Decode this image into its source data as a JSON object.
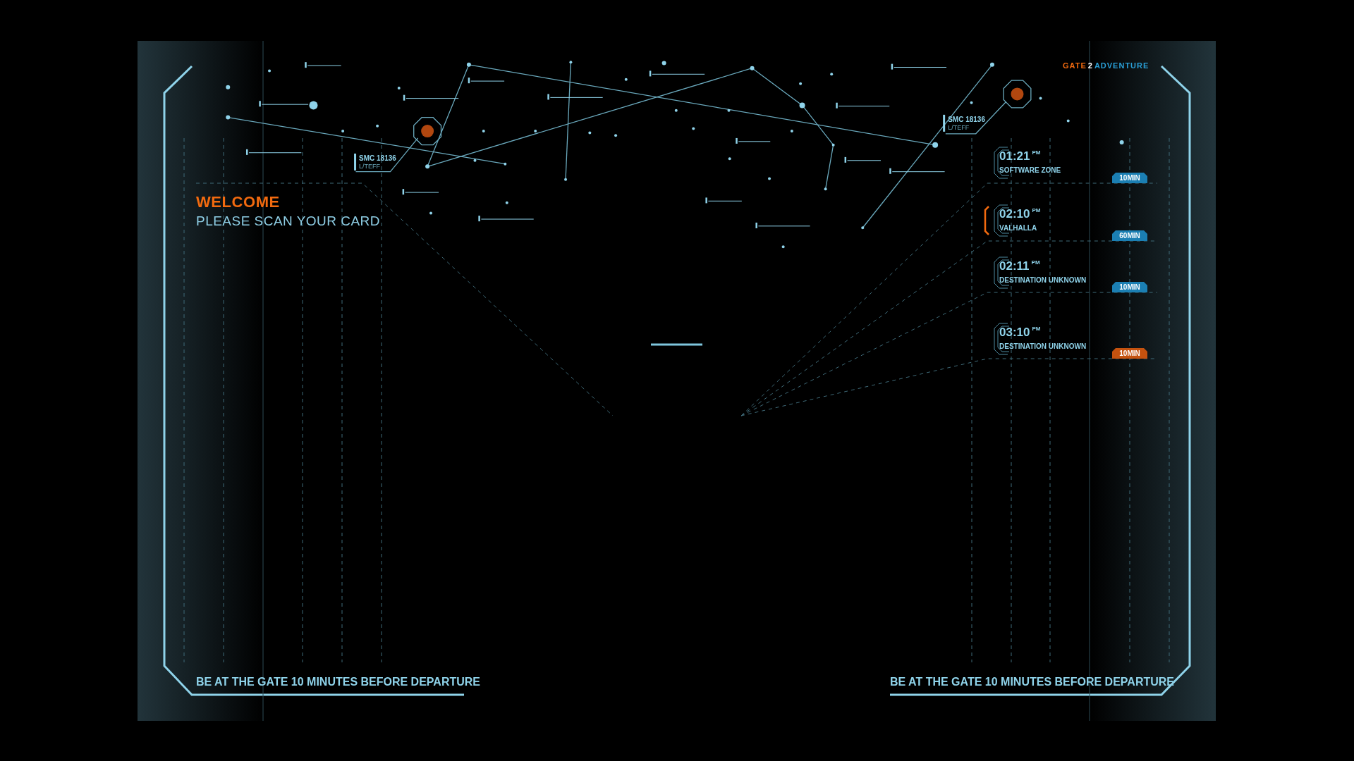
{
  "brand": {
    "first": "GATE",
    "middle": "2",
    "last": "ADVENTURE"
  },
  "welcome": {
    "title": "WELCOME",
    "prompt": "PLEASE SCAN YOUR CARD"
  },
  "star_labels": [
    {
      "code": "SMC 18136",
      "sub": "L/TEFF"
    },
    {
      "code": "SMC 18136",
      "sub": "L/TEFF"
    }
  ],
  "departures": [
    {
      "time": "01:21",
      "meridiem": "PM",
      "destination": "SOFTWARE ZONE",
      "badge": "10MIN",
      "color": "#1b7fb3",
      "selected": false
    },
    {
      "time": "02:10",
      "meridiem": "PM",
      "destination": "VALHALLA",
      "badge": "60MIN",
      "color": "#1b7fb3",
      "selected": true
    },
    {
      "time": "02:11",
      "meridiem": "PM",
      "destination": "DESTINATION UNKNOWN",
      "badge": "10MIN",
      "color": "#1b7fb3",
      "selected": false
    },
    {
      "time": "03:10",
      "meridiem": "PM",
      "destination": "DESTINATION UNKNOWN",
      "badge": "10MIN",
      "color": "#c4520f",
      "selected": false
    }
  ],
  "notices": [
    "BE AT THE GATE 10 MINUTES BEFORE DEPARTURE",
    "BE AT THE GATE 10 MINUTES BEFORE DEPARTURE"
  ]
}
